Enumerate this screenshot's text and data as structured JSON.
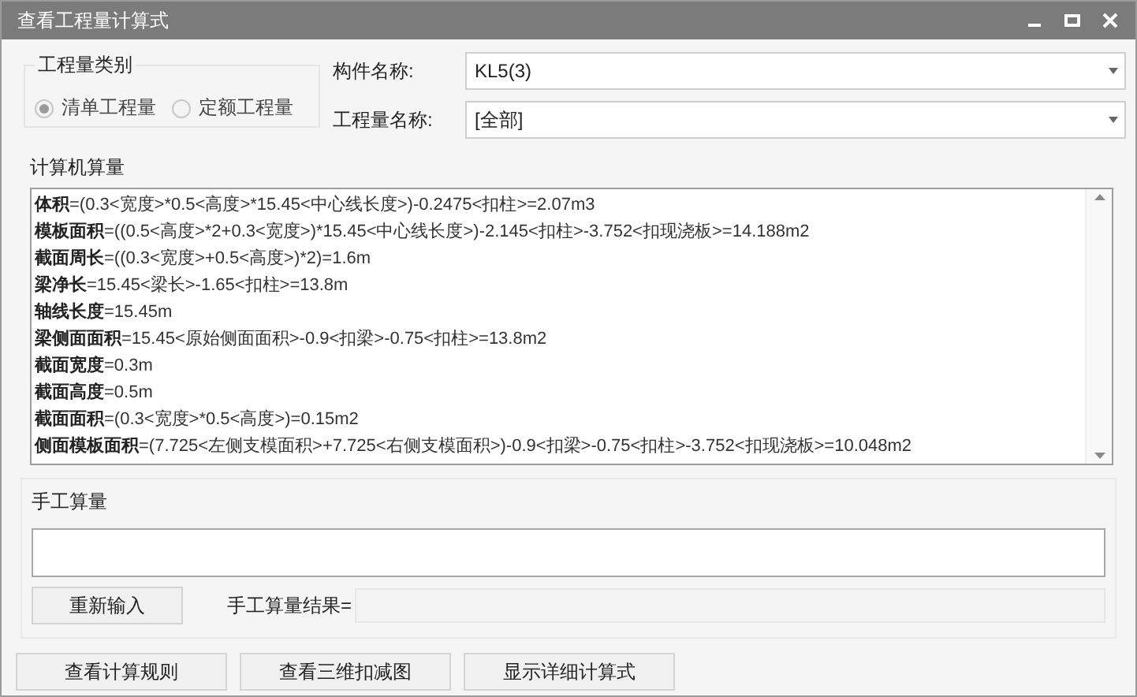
{
  "window": {
    "title": "查看工程量计算式"
  },
  "quantity_type": {
    "label": "工程量类别",
    "options": [
      {
        "label": "清单工程量",
        "selected": true,
        "disabled": true
      },
      {
        "label": "定额工程量",
        "selected": false,
        "disabled": true
      }
    ]
  },
  "fields": [
    {
      "label": "构件名称:",
      "value": "KL5(3)"
    },
    {
      "label": "工程量名称:",
      "value": "[全部]"
    }
  ],
  "computed": {
    "label": "计算机算量",
    "lines": [
      "**体积**=(0.3<宽度>*0.5<高度>*15.45<中心线长度>)-0.2475<扣柱>=2.07m3",
      "**模板面积**=((0.5<高度>*2+0.3<宽度>)*15.45<中心线长度>)-2.145<扣柱>-3.752<扣现浇板>=14.188m2",
      "**截面周长**=((0.3<宽度>+0.5<高度>)*2)=1.6m",
      "**梁净长**=15.45<梁长>-1.65<扣柱>=13.8m",
      "**轴线长度**=15.45m",
      "**梁侧面面积**=15.45<原始侧面面积>-0.9<扣梁>-0.75<扣柱>=13.8m2",
      "**截面宽度**=0.3m",
      "**截面高度**=0.5m",
      "**截面面积**=(0.3<宽度>*0.5<高度>)=0.15m2",
      "**侧面模板面积**=(7.725<左侧支模面积>+7.725<右侧支模面积>)-0.9<扣梁>-0.75<扣柱>-3.752<扣现浇板>=10.048m2"
    ]
  },
  "manual": {
    "label": "手工算量",
    "reset_button": "重新输入",
    "result_label": "手工算量结果="
  },
  "buttons": [
    "查看计算规则",
    "查看三维扣减图",
    "显示详细计算式"
  ]
}
